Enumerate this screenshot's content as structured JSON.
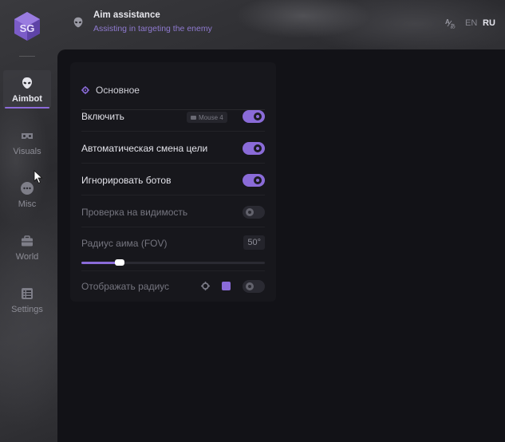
{
  "sidebar": {
    "items": [
      {
        "label": "Aimbot",
        "icon": "alien-icon",
        "active": true
      },
      {
        "label": "Visuals",
        "icon": "vr-goggles-icon",
        "active": false
      },
      {
        "label": "Misc",
        "icon": "more-dots-icon",
        "active": false
      },
      {
        "label": "World",
        "icon": "briefcase-icon",
        "active": false
      },
      {
        "label": "Settings",
        "icon": "list-icon",
        "active": false
      }
    ]
  },
  "header": {
    "title": "Aim assistance",
    "subtitle": "Assisting in targeting the enemy",
    "icon": "alien-icon",
    "lang_icon": "translate-icon",
    "languages": {
      "en": "EN",
      "ru": "RU"
    },
    "selected_language": "RU"
  },
  "panel": {
    "title": "Основное",
    "rows": {
      "enable": {
        "label": "Включить",
        "keybind": "Mouse 4",
        "on": true
      },
      "auto_switch": {
        "label": "Автоматическая смена цели",
        "on": true
      },
      "ignore_bots": {
        "label": "Игнорировать ботов",
        "on": true
      },
      "visibility_check": {
        "label": "Проверка на видимость",
        "on": false
      },
      "fov": {
        "label": "Радиус аима (FOV)",
        "value": "50°",
        "slider_fraction": 0.21
      },
      "show_radius": {
        "label": "Отображать радиус",
        "on": false,
        "swatch_color": "#8a6bd8"
      }
    }
  },
  "colors": {
    "accent": "#8a6bd8",
    "panel_bg": "#17171c",
    "main_bg": "#121217"
  }
}
